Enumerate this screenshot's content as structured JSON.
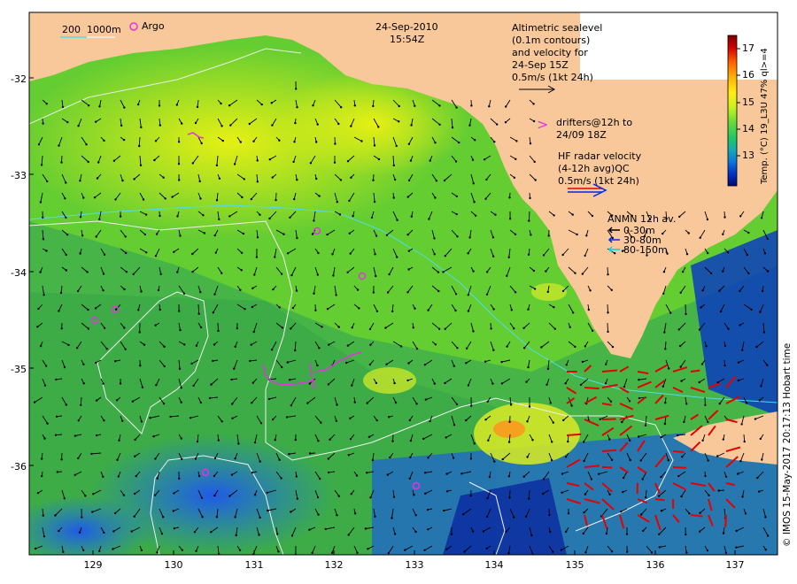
{
  "header": {
    "date": "24-Sep-2010",
    "time": "15:54Z"
  },
  "bathy_legend": {
    "depth1": "200",
    "depth2": "1000m"
  },
  "argo_label": "Argo",
  "altimetry": {
    "lines": [
      "Altimetric sealevel",
      "(0.1m contours)",
      "and velocity for",
      "24-Sep 15Z",
      "0.5m/s (1kt 24h)"
    ]
  },
  "drifters": {
    "marker": ">",
    "lines": [
      "drifters@12h to",
      "24/09 18Z"
    ]
  },
  "hf_radar": {
    "lines": [
      "HF radar velocity",
      "(4-12h avg)QC",
      "0.5m/s (1kt 24h)"
    ]
  },
  "anmn": {
    "title": "ANMN 12h av.",
    "items": [
      "0-30m",
      "30-80m",
      "80-150m"
    ]
  },
  "colorbar": {
    "label": "Temp. (°C) 19_L3U 47% ql>=4",
    "ticks": [
      "17",
      "16",
      "15",
      "14",
      "13"
    ],
    "colors": [
      "#7a0000",
      "#c80000",
      "#ff3c00",
      "#ff9600",
      "#ffe600",
      "#d2ff1e",
      "#8cf03c",
      "#3cd23c",
      "#14b48c",
      "#0a8cd2",
      "#0050e6",
      "#001eb4",
      "#000a6e"
    ]
  },
  "credit": "© IMOS 15-May-2017 20:17:13 Hobart time",
  "axes": {
    "yticks": [
      "-32",
      "-33",
      "-34",
      "-35",
      "-36"
    ],
    "xticks": [
      "129",
      "130",
      "131",
      "132",
      "133",
      "134",
      "135",
      "136",
      "137"
    ]
  },
  "colors": {
    "land": "#f8c89a",
    "sea_green": "#5ec83c",
    "sea_yellow": "#d8f01e",
    "sea_blue": "#1e78e6",
    "hf_arrow": "#e60000"
  }
}
